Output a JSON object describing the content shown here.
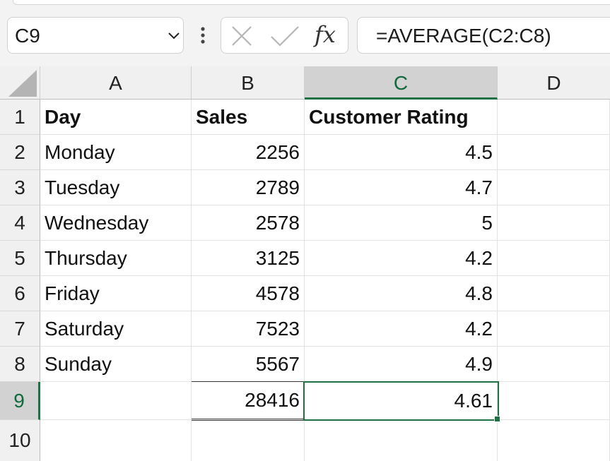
{
  "formula_bar": {
    "name_box": "C9",
    "fx_label": "fx",
    "formula": "=AVERAGE(C2:C8)"
  },
  "columns": [
    "A",
    "B",
    "C",
    "D"
  ],
  "rows": [
    "1",
    "2",
    "3",
    "4",
    "5",
    "6",
    "7",
    "8",
    "9",
    "10"
  ],
  "cells": {
    "header": {
      "a": "Day",
      "b": "Sales",
      "c": "Customer Rating"
    },
    "data": [
      {
        "a": "Monday",
        "b": "2256",
        "c": "4.5"
      },
      {
        "a": "Tuesday",
        "b": "2789",
        "c": "4.7"
      },
      {
        "a": "Wednesday",
        "b": "2578",
        "c": "5"
      },
      {
        "a": "Thursday",
        "b": "3125",
        "c": "4.2"
      },
      {
        "a": "Friday",
        "b": "4578",
        "c": "4.8"
      },
      {
        "a": "Saturday",
        "b": "7523",
        "c": "4.2"
      },
      {
        "a": "Sunday",
        "b": "5567",
        "c": "4.9"
      }
    ],
    "total": {
      "b": "28416",
      "c": "4.61"
    }
  },
  "selection": {
    "active_cell": "C9",
    "accent": "#1e7145"
  }
}
